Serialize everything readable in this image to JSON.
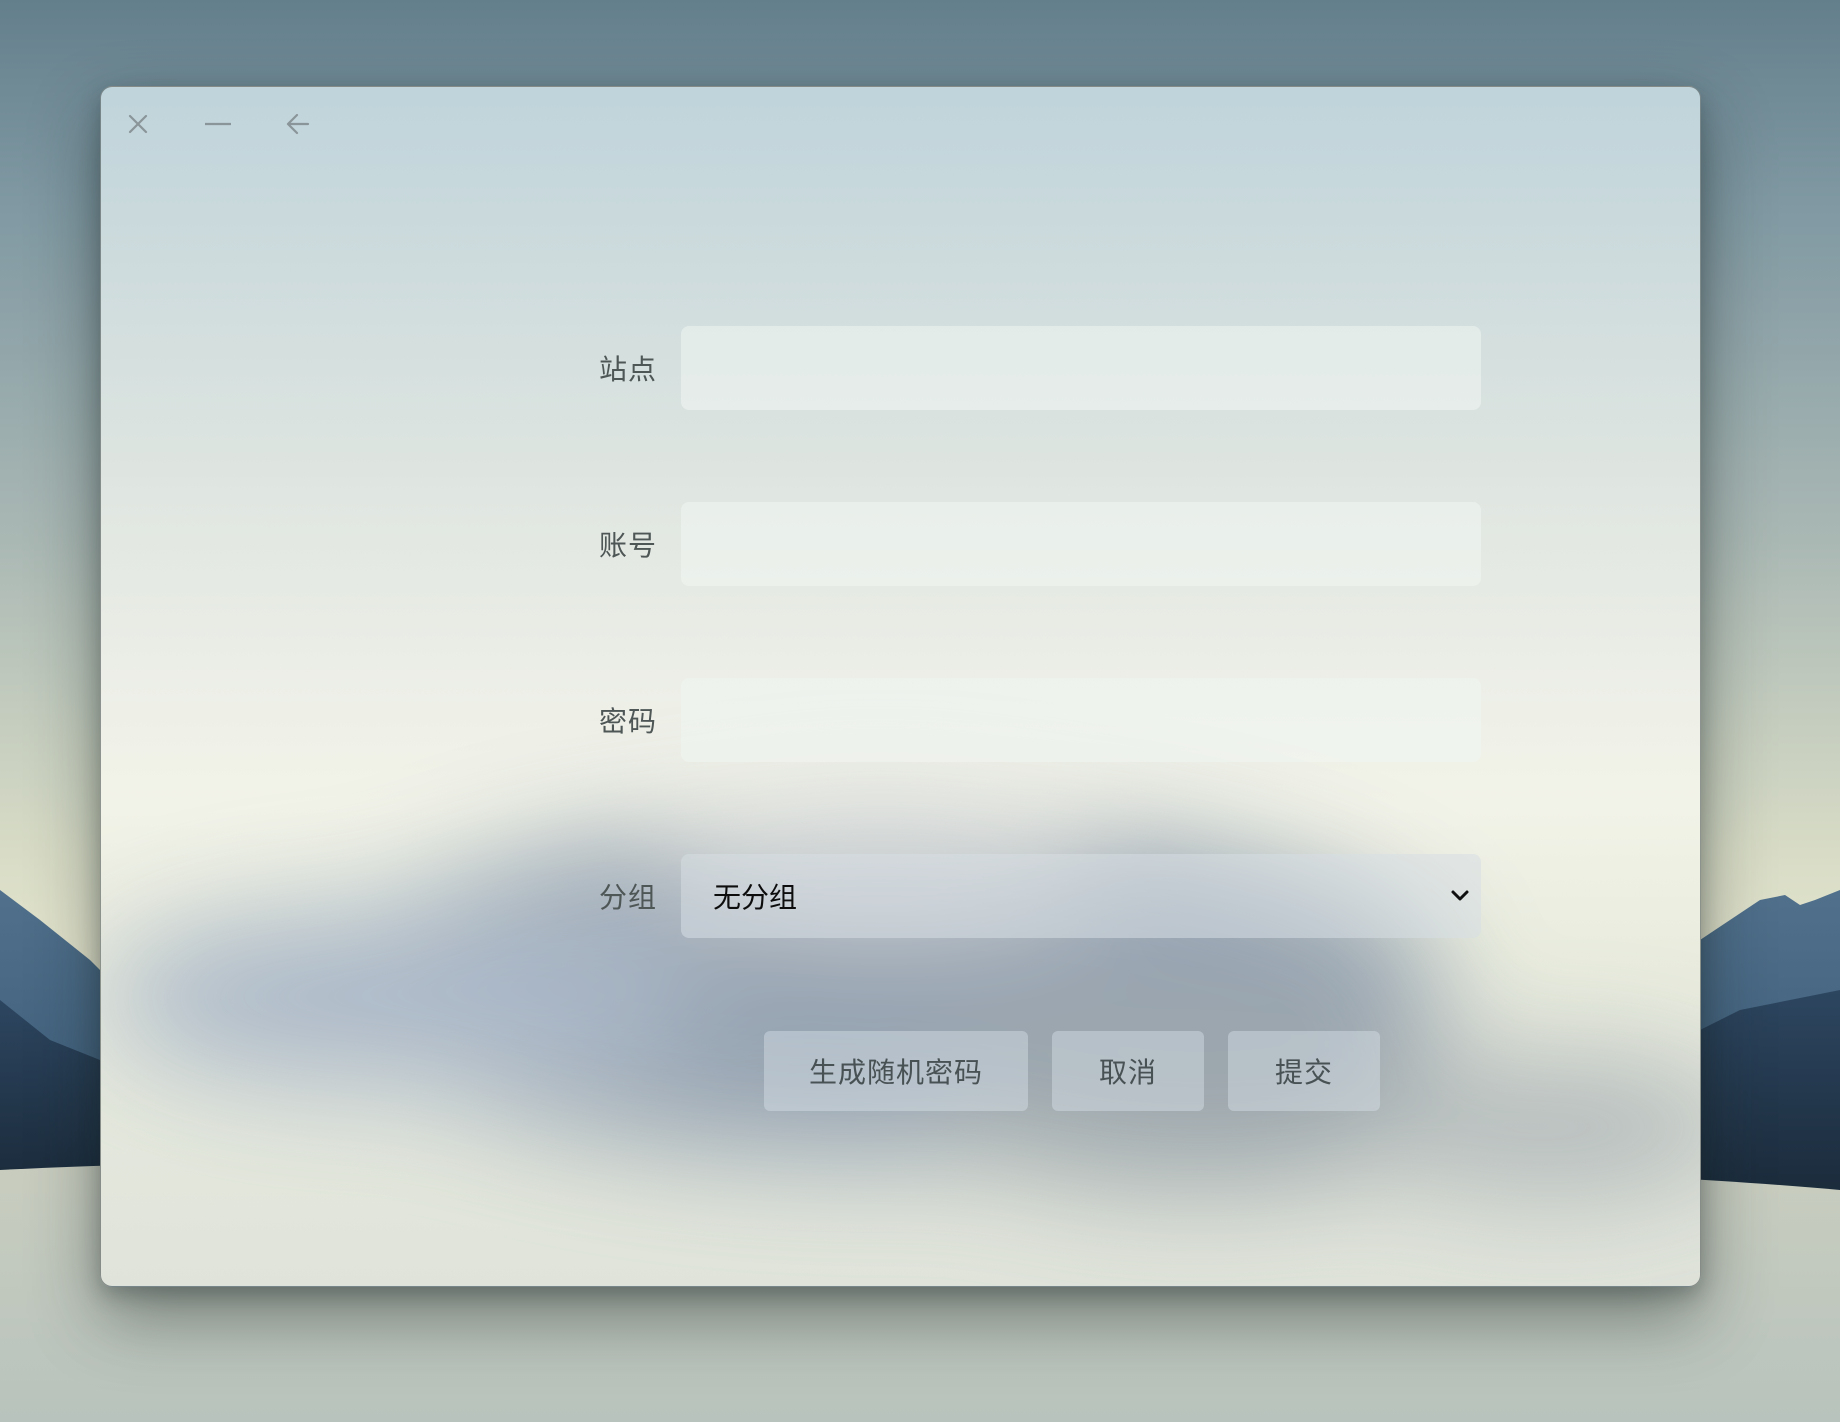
{
  "window": {
    "controls": [
      "close-icon",
      "minimize-icon",
      "back-arrow-icon"
    ]
  },
  "form": {
    "site": {
      "label": "站点",
      "value": ""
    },
    "account": {
      "label": "账号",
      "value": ""
    },
    "password": {
      "label": "密码",
      "value": ""
    },
    "group": {
      "label": "分组",
      "selected": "无分组"
    }
  },
  "actions": {
    "generate_label": "生成随机密码",
    "cancel_label": "取消",
    "submit_label": "提交"
  },
  "colors": {
    "label_text": "#4e5656",
    "button_text": "#485154"
  }
}
